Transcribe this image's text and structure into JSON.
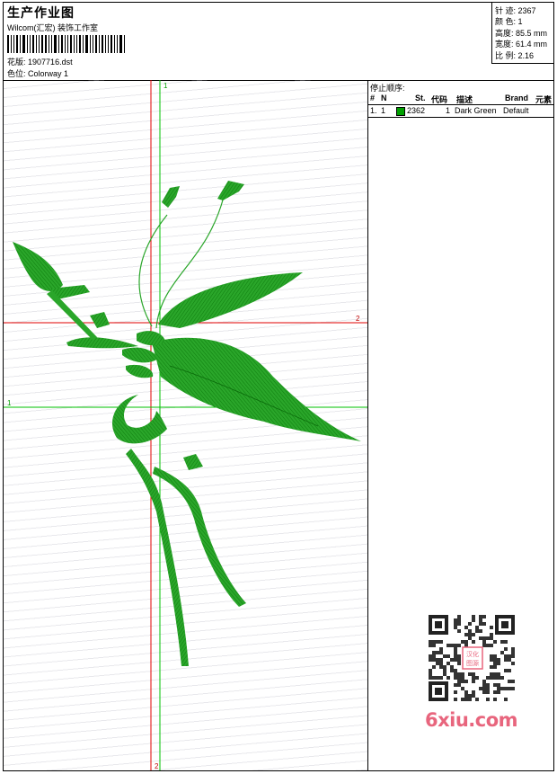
{
  "header": {
    "title": "生产作业图",
    "subtitle": "Wilcom(汇宏) 装饰工作室",
    "design_label": "花版:",
    "design_value": "1907716.dst",
    "colorway_label": "色位:",
    "colorway_value": "Colorway 1"
  },
  "stats": {
    "stitches": "针 迹: 2367",
    "colors": "颜 色: 1",
    "height": "高度: 85.5 mm",
    "width": "宽度: 61.4 mm",
    "scale": "比 例: 2.16"
  },
  "stop_sequence": {
    "heading": "停止顺序:",
    "columns": {
      "num": "#",
      "n": "N",
      "st": "St.",
      "code": "代码",
      "desc": "描述",
      "brand": "Brand",
      "element": "元素"
    },
    "rows": [
      {
        "num": "1.",
        "n": "1",
        "st": "2362",
        "code": "1",
        "desc": "Dark Green",
        "brand": "Default",
        "color": "#00a000"
      }
    ]
  },
  "axes": {
    "vertical_top": "1",
    "vertical_bottom": "2",
    "horizontal_right": "2",
    "horizontal_left": "1",
    "red_color": "#e00000",
    "green_color": "#00c000"
  },
  "embroidery": {
    "thread_color": "#1a9a1a"
  },
  "watermark": {
    "text": "6xiu.com",
    "qr_label_top": "汉化",
    "qr_label_bottom": "图源"
  }
}
